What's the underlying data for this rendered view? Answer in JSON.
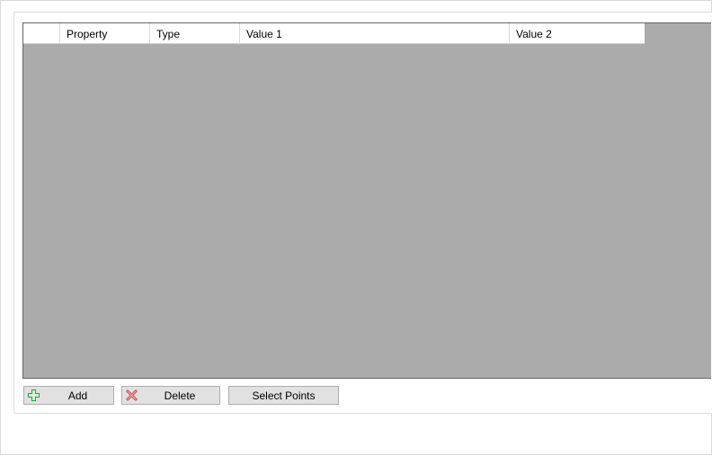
{
  "grid": {
    "columns": [
      {
        "key": "rowheader",
        "label": ""
      },
      {
        "key": "property",
        "label": "Property"
      },
      {
        "key": "type",
        "label": "Type"
      },
      {
        "key": "value1",
        "label": "Value 1"
      },
      {
        "key": "value2",
        "label": "Value 2"
      }
    ],
    "rows": [],
    "background_color": "#ababab"
  },
  "buttons": {
    "add": {
      "label": "Add",
      "icon": "plus-icon",
      "icon_color": "#2e9e3e"
    },
    "delete": {
      "label": "Delete",
      "icon": "delete-x-icon",
      "icon_color": "#c8404a"
    },
    "select_points": {
      "label": "Select Points"
    }
  }
}
